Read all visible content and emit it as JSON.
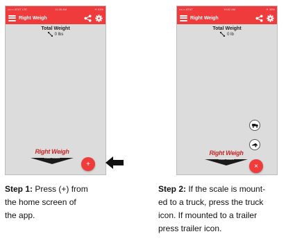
{
  "phone1": {
    "status_carrier": "•••○○ AT&T LTE",
    "status_time": "11:26 AM",
    "status_battery": "✈ 61%",
    "app_title": "Right Weigh",
    "total_weight_label": "Total Weight",
    "weight_value": "0 lbs",
    "logo_text": "Right Weigh",
    "logo_sub": "Load Scales",
    "fab_label": "+"
  },
  "phone2": {
    "status_carrier": "•••○○ AT&T",
    "status_time": "10:02 AM",
    "status_battery": "✈ 38%",
    "app_title": "Right Weigh",
    "total_weight_label": "Total Weight",
    "weight_value": "0 lb",
    "logo_text": "Right Weigh",
    "logo_sub": "Load Scales",
    "fab_label": "×"
  },
  "captions": {
    "step1_title": "Step 1:",
    "step1_lines": [
      " Press (+) from",
      "the home screen of",
      "the app."
    ],
    "step2_title": "Step 2:",
    "step2_lines": [
      " If the scale is mount-",
      "ed to a truck, press the truck",
      "icon.  If mounted to a trailer",
      "press trailer icon."
    ]
  },
  "colors": {
    "accent": "#ef3b3b",
    "screen_bg": "#dcdcdc"
  },
  "icons": [
    "menu-icon",
    "share-icon",
    "gear-icon",
    "scale-arrows-icon",
    "truck-icon",
    "trailer-icon",
    "arrow-left-icon"
  ]
}
